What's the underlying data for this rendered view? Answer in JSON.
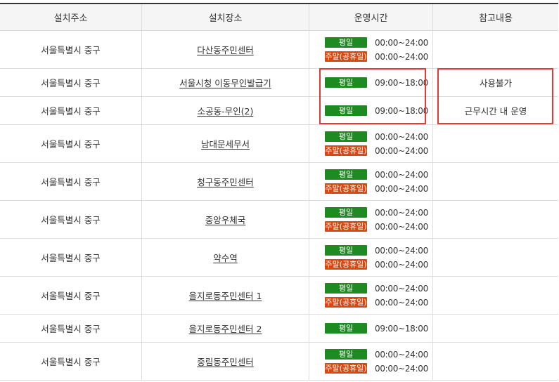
{
  "header": {
    "col_address": "설치주소",
    "col_place": "설치장소",
    "col_hours": "운영시간",
    "col_note": "참고내용"
  },
  "labels": {
    "weekday": "평일",
    "weekend": "주말(공휴일)"
  },
  "colors": {
    "weekday_badge": "#1e8a22",
    "weekend_badge": "#d9480f",
    "highlight": "#e53935"
  },
  "rows": [
    {
      "address": "서울특별시 중구",
      "place": "다산동주민센터",
      "weekday_time": "00:00~24:00",
      "weekend_time": "00:00~24:00",
      "note": ""
    },
    {
      "address": "서울특별시 중구",
      "place": "서울시청 이동무인발급기",
      "weekday_time": "09:00~18:00",
      "note": "사용불가"
    },
    {
      "address": "서울특별시 중구",
      "place": "소공동-무인(2)",
      "weekday_time": "09:00~18:00",
      "note": "근무시간 내 운영"
    },
    {
      "address": "서울특별시 중구",
      "place": "남대문세무서",
      "weekday_time": "00:00~24:00",
      "weekend_time": "00:00~24:00",
      "note": ""
    },
    {
      "address": "서울특별시 중구",
      "place": "청구동주민센터",
      "weekday_time": "00:00~24:00",
      "weekend_time": "00:00~24:00",
      "note": ""
    },
    {
      "address": "서울특별시 중구",
      "place": "중앙우체국",
      "weekday_time": "00:00~24:00",
      "weekend_time": "00:00~24:00",
      "note": ""
    },
    {
      "address": "서울특별시 중구",
      "place": "약수역",
      "weekday_time": "00:00~24:00",
      "weekend_time": "00:00~24:00",
      "note": ""
    },
    {
      "address": "서울특별시 중구",
      "place": "을지로동주민센터 1",
      "weekday_time": "00:00~24:00",
      "weekend_time": "00:00~24:00",
      "note": ""
    },
    {
      "address": "서울특별시 중구",
      "place": "을지로동주민센터 2",
      "weekday_time": "09:00~18:00",
      "note": ""
    },
    {
      "address": "서울특별시 중구",
      "place": "중림동주민센터",
      "weekday_time": "00:00~24:00",
      "weekend_time": "00:00~24:00",
      "note": ""
    }
  ]
}
